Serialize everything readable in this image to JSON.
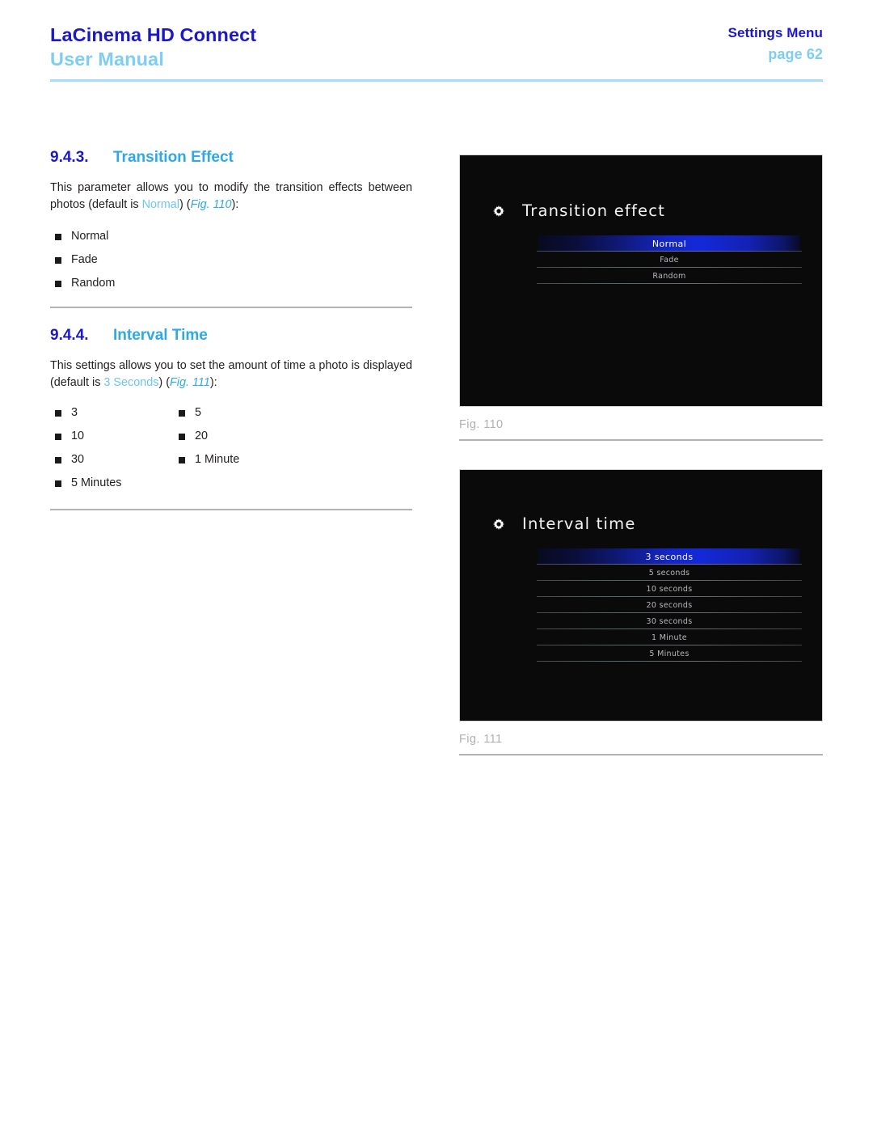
{
  "header": {
    "product": "LaCinema HD Connect",
    "doc_type": "User Manual",
    "section": "Settings Menu",
    "page": "page 62",
    "accent_dark": "#1b18c8",
    "accent_light": "#7ecdf3"
  },
  "sections": [
    {
      "number": "9.4.3.",
      "title": "Transition Effect",
      "paragraph_parts": {
        "p1": "This parameter allows you to modify the transition effects between photos (default is ",
        "accent": "Normal",
        "p2": ") (",
        "figref": "Fig. 110",
        "p3": "):"
      },
      "bullets": [
        "Normal",
        "Fade",
        "Random"
      ]
    },
    {
      "number": "9.4.4.",
      "title": "Interval Time",
      "paragraph_parts": {
        "p1": "This settings allows you to set the amount of time a photo is displayed (default is ",
        "accent": "3 Seconds",
        "p2": ") (",
        "figref": "Fig. 111",
        "p3": "):"
      },
      "bullets_col1": [
        "3",
        "10",
        "30",
        "5 Minutes"
      ],
      "bullets_col2": [
        "5",
        "20",
        "1 Minute"
      ]
    }
  ],
  "figures": [
    {
      "caption": "Fig. 110",
      "screen": {
        "icon": "gear-icon",
        "title": "Transition effect",
        "items": [
          {
            "label": "Normal",
            "selected": true
          },
          {
            "label": "Fade",
            "selected": false
          },
          {
            "label": "Random",
            "selected": false
          }
        ]
      }
    },
    {
      "caption": "Fig. 111",
      "screen": {
        "icon": "gear-icon",
        "title": "Interval time",
        "items": [
          {
            "label": "3 seconds",
            "selected": true
          },
          {
            "label": "5 seconds",
            "selected": false
          },
          {
            "label": "10 seconds",
            "selected": false
          },
          {
            "label": "20 seconds",
            "selected": false
          },
          {
            "label": "30 seconds",
            "selected": false
          },
          {
            "label": "1 Minute",
            "selected": false
          },
          {
            "label": "5 Minutes",
            "selected": false
          }
        ]
      }
    }
  ],
  "colors": {
    "highlight_blue": "#1526c8",
    "screen_bg": "#0a0a0b",
    "divider": "#b3b3b3",
    "caption": "#b0b0b0"
  }
}
